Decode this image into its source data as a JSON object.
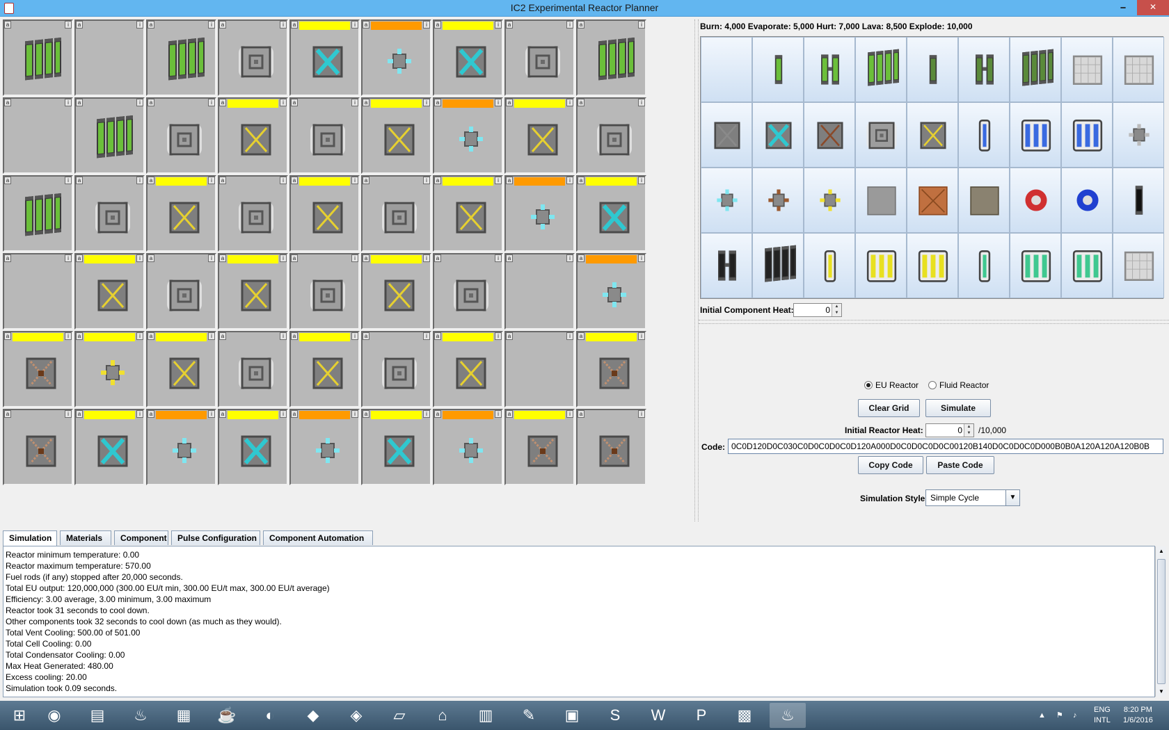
{
  "window": {
    "title": "IC2 Experimental Reactor Planner",
    "minimize": "🗕",
    "maximize": "🗗",
    "close": "✕"
  },
  "grid": {
    "rows": [
      [
        {
          "c": "quad",
          "b": ""
        },
        {
          "c": "empty",
          "b": ""
        },
        {
          "c": "quad",
          "b": ""
        },
        {
          "c": "vent",
          "b": ""
        },
        {
          "c": "cyan",
          "b": "y"
        },
        {
          "c": "small-cyan",
          "b": "o"
        },
        {
          "c": "cyan",
          "b": "y"
        },
        {
          "c": "vent",
          "b": ""
        },
        {
          "c": "quad",
          "b": ""
        }
      ],
      [
        {
          "c": "empty",
          "b": ""
        },
        {
          "c": "quad",
          "b": ""
        },
        {
          "c": "vent",
          "b": ""
        },
        {
          "c": "yellow",
          "b": "y"
        },
        {
          "c": "vent",
          "b": ""
        },
        {
          "c": "yellow",
          "b": "y"
        },
        {
          "c": "small-cyan",
          "b": "o"
        },
        {
          "c": "yellow",
          "b": "y"
        },
        {
          "c": "vent",
          "b": ""
        }
      ],
      [
        {
          "c": "quad",
          "b": ""
        },
        {
          "c": "vent",
          "b": ""
        },
        {
          "c": "yellow",
          "b": "y"
        },
        {
          "c": "vent",
          "b": ""
        },
        {
          "c": "yellow",
          "b": "y"
        },
        {
          "c": "vent",
          "b": ""
        },
        {
          "c": "yellow",
          "b": "y"
        },
        {
          "c": "small-cyan",
          "b": "o"
        },
        {
          "c": "cyan",
          "b": "y"
        }
      ],
      [
        {
          "c": "empty",
          "b": ""
        },
        {
          "c": "yellow",
          "b": "y"
        },
        {
          "c": "vent",
          "b": ""
        },
        {
          "c": "yellow",
          "b": "y"
        },
        {
          "c": "vent",
          "b": ""
        },
        {
          "c": "yellow",
          "b": "y"
        },
        {
          "c": "vent",
          "b": ""
        },
        {
          "c": "empty",
          "b": ""
        },
        {
          "c": "small-cyan",
          "b": "o"
        }
      ],
      [
        {
          "c": "brown",
          "b": "y"
        },
        {
          "c": "small-yellow",
          "b": "y"
        },
        {
          "c": "yellow",
          "b": "y"
        },
        {
          "c": "vent",
          "b": ""
        },
        {
          "c": "yellow",
          "b": "y"
        },
        {
          "c": "vent",
          "b": ""
        },
        {
          "c": "yellow",
          "b": "y"
        },
        {
          "c": "empty",
          "b": ""
        },
        {
          "c": "brown",
          "b": "y"
        }
      ],
      [
        {
          "c": "brown",
          "b": ""
        },
        {
          "c": "cyan",
          "b": "y"
        },
        {
          "c": "small-cyan",
          "b": "o"
        },
        {
          "c": "cyan",
          "b": "y"
        },
        {
          "c": "small-cyan",
          "b": "o"
        },
        {
          "c": "cyan",
          "b": "y"
        },
        {
          "c": "small-cyan",
          "b": "o"
        },
        {
          "c": "brown",
          "b": "y"
        },
        {
          "c": "brown",
          "b": ""
        }
      ]
    ]
  },
  "heat_info": "Burn: 4,000   Evaporate: 5,000   Hurt: 7,000   Lava: 8,500   Explode: 10,000",
  "palette": [
    [
      "empty",
      "single",
      "dual",
      "quad",
      "single-mox",
      "dual-mox",
      "quad-mox",
      "plating",
      "plating-heat"
    ],
    [
      "vent-grey",
      "cyan",
      "brown-vent",
      "vent",
      "yellow",
      "coolant-10k",
      "coolant-30k",
      "coolant-60k",
      "small-grey"
    ],
    [
      "small-cyan",
      "small-brown",
      "small-yellow",
      "plating-plain",
      "plating-copper",
      "plating-dots",
      "red-gear",
      "blue-gear",
      "neutron"
    ],
    [
      "dual-dark",
      "quad-dark",
      "rsh-1",
      "rsh-3",
      "rsh-6",
      "lzh-1",
      "lzh-3",
      "lzh-6",
      "plating-grid"
    ]
  ],
  "initial_component_heat": {
    "label": "Initial Component Heat:",
    "value": "0"
  },
  "reactor_type": {
    "eu": "EU Reactor",
    "fluid": "Fluid Reactor",
    "selected": "eu"
  },
  "buttons": {
    "clear": "Clear Grid",
    "simulate": "Simulate",
    "copy": "Copy Code",
    "paste": "Paste Code"
  },
  "initial_reactor_heat": {
    "label": "Initial Reactor Heat:",
    "value": "0",
    "max": "/10,000"
  },
  "code": {
    "label": "Code:",
    "value": "0C0D120D0C030C0D0C0D0C0D120A000D0C0D0C0D0C00120B140D0C0D0C0D000B0B0A120A120A120B0B"
  },
  "simulation_style": {
    "label": "Simulation Style:",
    "value": "Simple Cycle"
  },
  "tabs": [
    "Simulation",
    "Materials",
    "Component",
    "Pulse Configuration",
    "Component Automation"
  ],
  "output_lines": [
    "Reactor minimum temperature: 0.00",
    "Reactor maximum temperature: 570.00",
    "Fuel rods (if any) stopped after 20,000 seconds.",
    "Total EU output: 120,000,000 (300.00 EU/t min, 300.00 EU/t max, 300.00 EU/t average)",
    "Efficiency: 3.00 average, 3.00 minimum, 3.00 maximum",
    "Reactor took 31 seconds to cool down.",
    "Other components took 32 seconds to cool down (as much as they would).",
    "Total Vent Cooling: 500.00 of 501.00",
    "Total Cell Cooling: 0.00",
    "Total Condensator Cooling: 0.00",
    "Max Heat Generated: 480.00",
    "Excess cooling: 20.00",
    "Simulation took 0.09 seconds."
  ],
  "taskbar": {
    "apps": [
      "windows-start",
      "chrome",
      "file-explorer",
      "fire-app",
      "minecraft-launcher",
      "teapot-app",
      "eclipse",
      "cube-app",
      "map-app",
      "notepad-app",
      "home-app",
      "chart-app",
      "paint-app",
      "vm-app",
      "skype",
      "word",
      "powerpoint",
      "minecraft",
      "java"
    ],
    "lang": "ENG",
    "layout": "INTL",
    "time": "8:20 PM",
    "date": "1/6/2016"
  },
  "colors": {
    "bar_yellow": "#ffff00",
    "bar_orange": "#ff9a00",
    "cell_bg": "#b8b8b8",
    "title_bg": "#62b6f0"
  }
}
